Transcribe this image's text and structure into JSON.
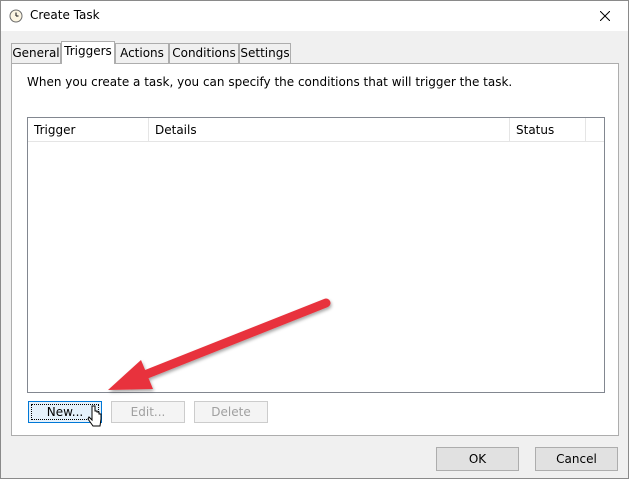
{
  "window": {
    "title": "Create Task",
    "icon": "clock-icon",
    "close_icon": "close-icon"
  },
  "tabs": [
    {
      "label": "General",
      "active": false
    },
    {
      "label": "Triggers",
      "active": true
    },
    {
      "label": "Actions",
      "active": false
    },
    {
      "label": "Conditions",
      "active": false
    },
    {
      "label": "Settings",
      "active": false
    }
  ],
  "triggers": {
    "description": "When you create a task, you can specify the conditions that will trigger the task.",
    "columns": [
      "Trigger",
      "Details",
      "Status"
    ],
    "rows": [],
    "buttons": {
      "new": "New...",
      "edit": "Edit...",
      "delete": "Delete"
    }
  },
  "footer": {
    "ok": "OK",
    "cancel": "Cancel"
  },
  "annotation": {
    "arrow_color": "#e8333c",
    "cursor_icon": "hand-pointer-icon"
  }
}
